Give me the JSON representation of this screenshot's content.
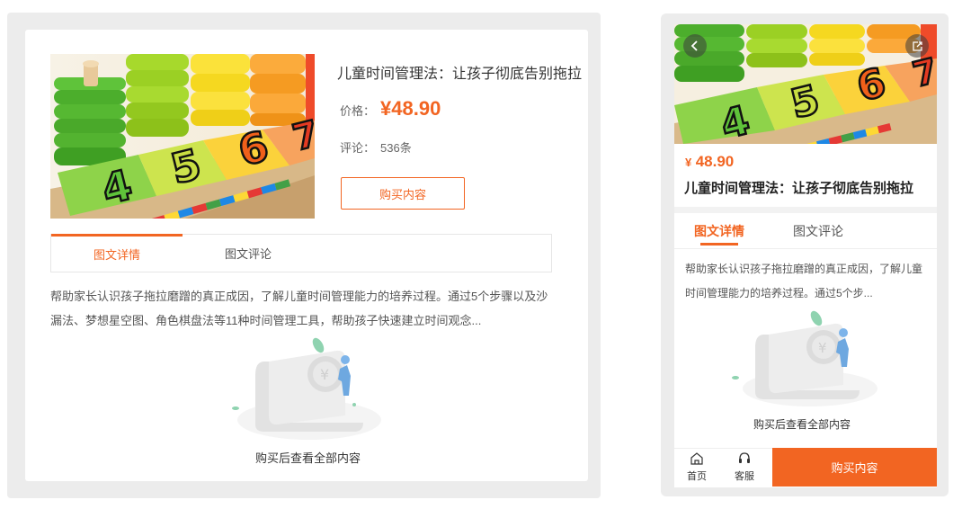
{
  "product": {
    "title": "儿童时间管理法：让孩子彻底告别拖拉",
    "price_label": "价格：",
    "price": "¥48.90",
    "comments_label": "评论：",
    "comments_count": "536条",
    "buy_label": "购买内容",
    "description": "帮助家长认识孩子拖拉磨蹭的真正成因，了解儿童时间管理能力的培养过程。通过5个步骤以及沙漏法、梦想星空图、角色棋盘法等11种时间管理工具，帮助孩子快速建立时间观念...",
    "locked_hint": "购买后查看全部内容"
  },
  "tabs": [
    "图文详情",
    "图文评论"
  ],
  "mobile": {
    "price_symbol": "¥",
    "price_value": "48.90",
    "description_short": "帮助家长认识孩子拖拉磨蹭的真正成因，了解儿童时间管理能力的培养过程。通过5个步...",
    "nav": [
      {
        "label": "首页",
        "icon": "home-icon"
      },
      {
        "label": "客服",
        "icon": "headset-icon"
      }
    ]
  },
  "cover_digits": [
    "4",
    "5",
    "6",
    "7"
  ],
  "colors": {
    "accent": "#f26522",
    "frame": "#ececec",
    "text": "#333333",
    "muted": "#666666"
  }
}
